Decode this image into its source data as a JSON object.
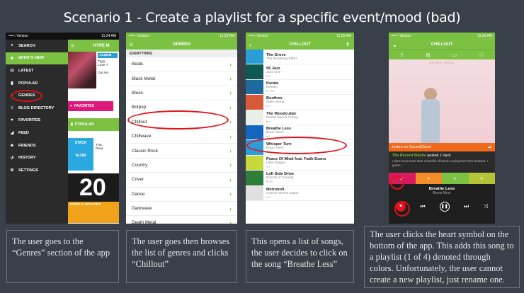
{
  "slide": {
    "title": "Scenario 1 - Create a playlist for a specific event/mood (bad)"
  },
  "phone1": {
    "status": {
      "carrier": "••••○ Verizon",
      "time": "11:24 AM"
    },
    "menu": [
      {
        "label": "SEARCH",
        "icon": "search-icon",
        "glyph": "⌕"
      },
      {
        "label": "WHAT'S NEW",
        "icon": "star-icon",
        "glyph": "★"
      },
      {
        "label": "LATEST",
        "icon": "clock-icon",
        "glyph": "◷"
      },
      {
        "label": "POPULAR",
        "icon": "bars-icon",
        "glyph": "▮"
      },
      {
        "label": "GENRES",
        "icon": "music-icon",
        "glyph": "♪"
      },
      {
        "label": "BLOG DIRECTORY",
        "icon": "list-icon",
        "glyph": "≡"
      },
      {
        "label": "FAVORITES",
        "icon": "heart-icon",
        "glyph": "♥"
      },
      {
        "label": "FEED",
        "icon": "feed-icon",
        "glyph": "◢"
      },
      {
        "label": "FRIENDS",
        "icon": "friends-icon",
        "glyph": "☻"
      },
      {
        "label": "HISTORY",
        "icon": "history-icon",
        "glyph": "↺"
      },
      {
        "label": "SETTINGS",
        "icon": "gear-icon",
        "glyph": "✲"
      }
    ],
    "header_title": "HYPE M",
    "album_label": "ALBUM",
    "album_text1": "Tyga",
    "album_text2": "Love T",
    "album_text3": "Out No",
    "favorites_label": "FAVORITES",
    "popular_label": "POPULAR",
    "stack_label": "STACK",
    "stack_number": "№166",
    "track_text1": "Trac",
    "track_text2": "Drea",
    "big_number": "20",
    "news_label": "NEWS & UPDATES"
  },
  "phone2": {
    "status": {
      "carrier": "••••○ Verizon",
      "time": "11:23 AM"
    },
    "header_title": "GENRES",
    "section_label": "EVERYTHING",
    "genres": [
      "Beats",
      "Black Metal",
      "Blues",
      "Britpop",
      "Chillout",
      "Chillwave",
      "Classic Rock",
      "Country",
      "Cover",
      "Dance",
      "Darkwave",
      "Death Metal"
    ]
  },
  "phone3": {
    "status": {
      "carrier": "••••○ Verizon",
      "time": "11:25 AM"
    },
    "header_title": "CHILLOUT",
    "songs": [
      {
        "title": "The Grove",
        "artist": "The Breathing Effect",
        "meta": "",
        "color": "#2a9fd6"
      },
      {
        "title": "95 Jazz",
        "artist": "Jazz One",
        "meta": "♥ 1",
        "color": "#0e5a52"
      },
      {
        "title": "Kerala",
        "artist": "bonobo",
        "meta": "♥ 2.6K",
        "color": "#1c6b9c"
      },
      {
        "title": "Bonfires",
        "artist": "Elder Island",
        "meta": "♥ 4",
        "color": "#d65a3a"
      },
      {
        "title": "The Woodcutter",
        "artist": "Desert Sound Colony",
        "meta": "♥ 4",
        "color": "#e9efe6"
      },
      {
        "title": "Breathe Less",
        "artist": "Bruno Merz",
        "meta": "♥ 2",
        "color": "#1565c0"
      },
      {
        "title": "Whisper Turn",
        "artist": "Bruno Merz",
        "meta": "♥ 1",
        "color": "#2e9cd8"
      },
      {
        "title": "Peace Of Mind feat. Faith Evans",
        "artist": "Little Dragon",
        "meta": "♥ 1",
        "color": "#c7d83e"
      },
      {
        "title": "Left Side Drive",
        "artist": "Boards of Canada",
        "meta": "♥ 782",
        "color": "#2e7d3a"
      },
      {
        "title": "Metrobolt",
        "artist": "Cosmo Versus Japan",
        "meta": "♥ 6",
        "color": "#e0e0e0"
      }
    ]
  },
  "phone4": {
    "status": {
      "carrier": "••••○ Verizon",
      "time": "11:26 AM"
    },
    "header_title": "CHILLOUT",
    "artist_overlay": "BRUNO MERZ",
    "soundcloud_label": "Listen on SoundCloud",
    "posted_blog": "The Record Stache",
    "posted_text": "posted",
    "posted_count": "1 track",
    "description": "I don't know more than a handful of bands coming from New Zealand. I guess...",
    "track_title": "Breathe Less",
    "track_artist": "Bruno Merz",
    "playlist_colors": [
      "#d81b60",
      "#f28c28",
      "#7bc142",
      "#b5c436"
    ]
  },
  "captions": [
    "The user goes to the “Genres” section of the app",
    "The user goes then browses the list of genres and clicks “Chillout”",
    "This opens a list of songs, the user decides to click on the song “Breathe Less”",
    "The user clicks the heart symbol on the bottom of the app. This adds this song to a playlist (1 of 4) denoted through colors. Unfortunately, the user cannot create a new playlist, just rename one."
  ],
  "colors": {
    "brand_green": "#7bc142",
    "highlight_red": "#e0121b",
    "background": "#3a4049"
  }
}
